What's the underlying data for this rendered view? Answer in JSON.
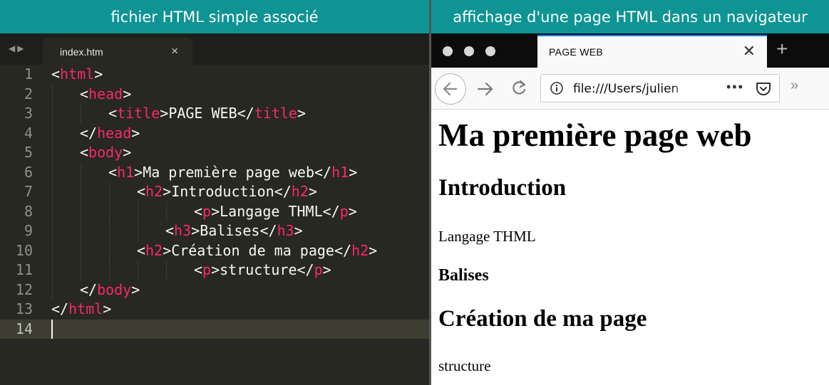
{
  "headers": {
    "left": "fichier HTML simple associé",
    "right": "affichage d'une page HTML dans un navigateur"
  },
  "editor": {
    "tab_name": "index.htm",
    "tab_close": "×",
    "nav_arrows": "◀▶",
    "lines": [
      {
        "n": "1"
      },
      {
        "n": "2"
      },
      {
        "n": "3"
      },
      {
        "n": "4"
      },
      {
        "n": "5"
      },
      {
        "n": "6"
      },
      {
        "n": "7"
      },
      {
        "n": "8"
      },
      {
        "n": "9"
      },
      {
        "n": "10"
      },
      {
        "n": "11"
      },
      {
        "n": "12"
      },
      {
        "n": "13"
      },
      {
        "n": "14"
      }
    ],
    "tokens": {
      "html": "html",
      "head": "head",
      "title": "title",
      "body": "body",
      "h1": "h1",
      "h2": "h2",
      "h3": "h3",
      "p": "p",
      "title_text": "PAGE WEB",
      "h1_text": "Ma première page web",
      "h2a_text": "Introduction",
      "p1_text": "Langage THML",
      "h3_text": "Balises",
      "h2b_text": "Création de ma page",
      "p2_text": "structure"
    }
  },
  "browser": {
    "tab_title": "PAGE WEB",
    "tab_close": "✕",
    "new_tab": "+",
    "url": "file:///Users/julien",
    "more": "•••",
    "overflow": "»",
    "page": {
      "h1": "Ma première page web",
      "h2a": "Introduction",
      "p1": "Langage THML",
      "h3": "Balises",
      "h2b": "Création de ma page",
      "p2": "structure"
    }
  },
  "colors": {
    "header_bg": "#0e9493",
    "editor_bg": "#272822",
    "tag_keyword": "#f92672",
    "browser_tab_accent": "#0a84ff"
  }
}
